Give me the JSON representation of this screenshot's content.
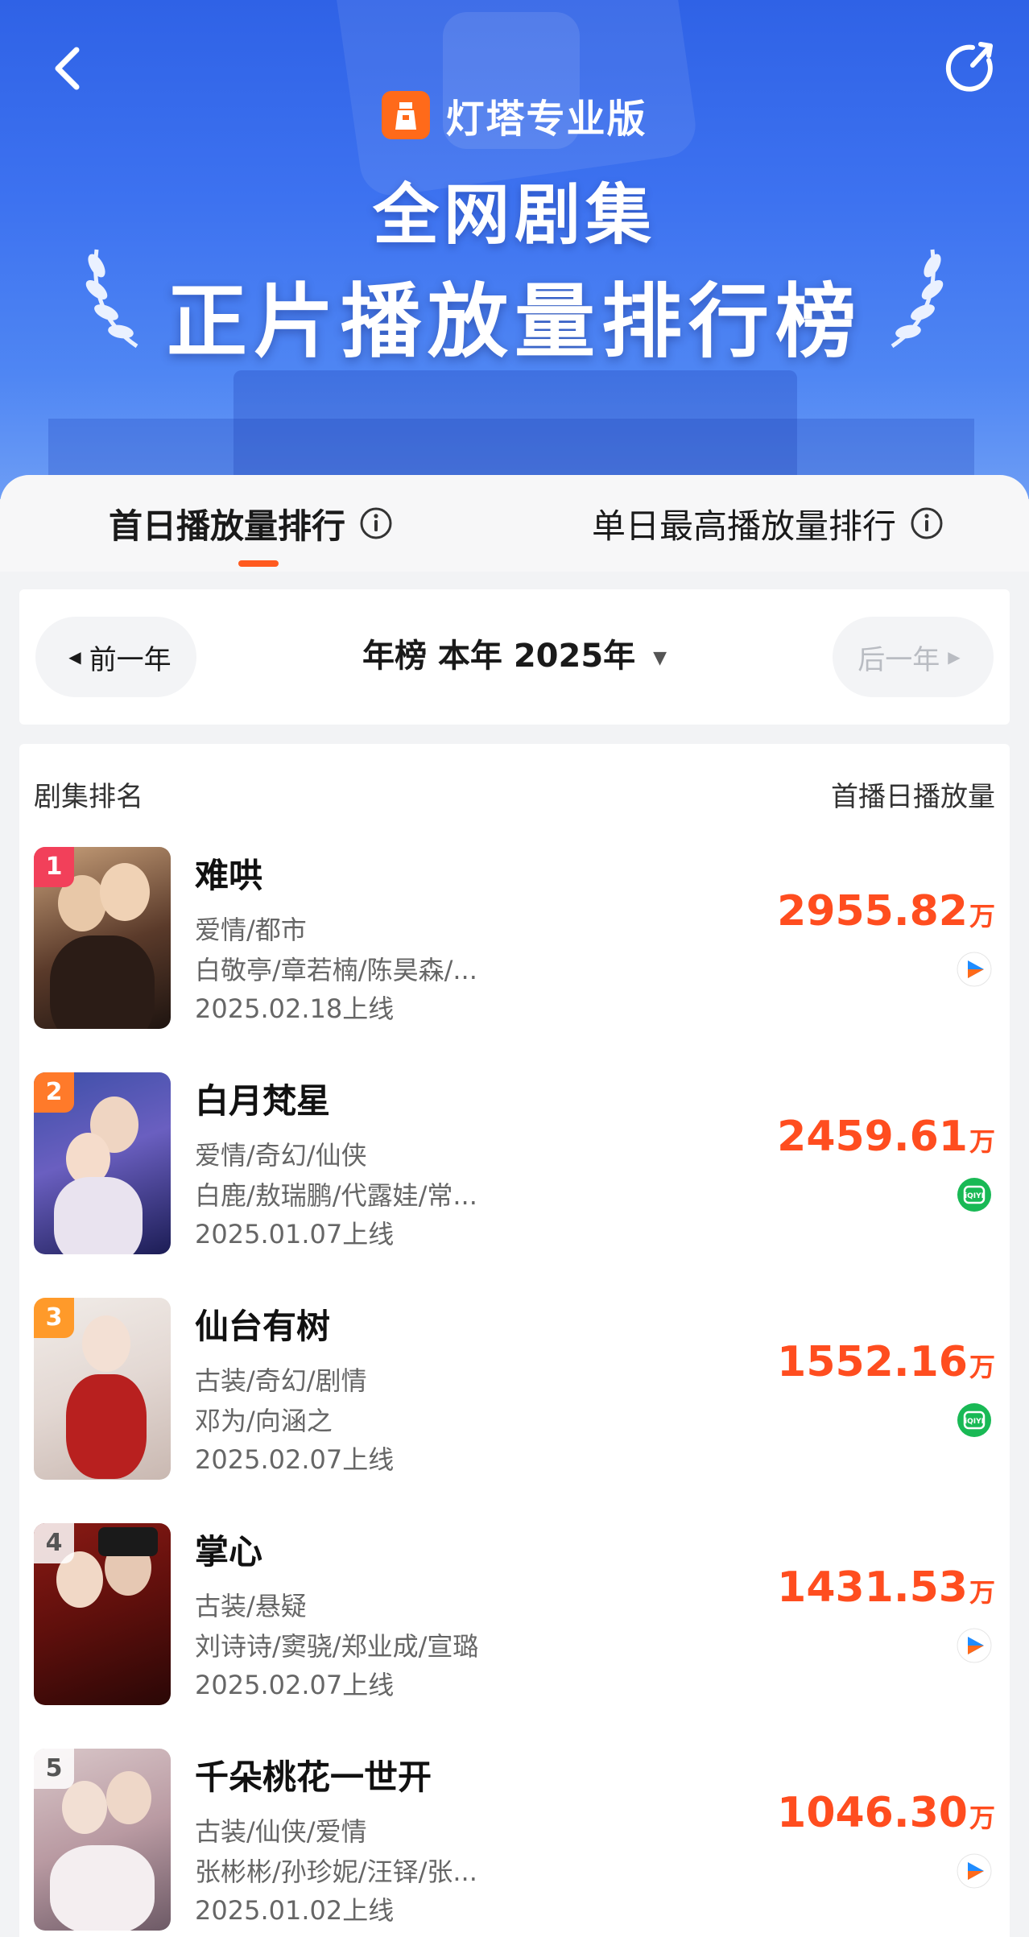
{
  "header": {
    "brand": "灯塔专业版",
    "title_line1": "全网剧集",
    "title_line2": "正片播放量排行榜"
  },
  "tabs": [
    {
      "label": "首日播放量排行",
      "active": true
    },
    {
      "label": "单日最高播放量排行",
      "active": false
    }
  ],
  "year_selector": {
    "prev_label": "前一年",
    "current_label": "年榜 本年 2025年",
    "next_label": "后一年"
  },
  "list": {
    "col_left": "剧集排名",
    "col_right": "首播日播放量",
    "items": [
      {
        "rank": "1",
        "name": "难哄",
        "genre": "爱情/都市",
        "cast": "白敬亭/章若楠/陈昊森/...",
        "date": "2025.02.18上线",
        "value": "2955.82",
        "unit": "万",
        "platform": "youku-icon"
      },
      {
        "rank": "2",
        "name": "白月梵星",
        "genre": "爱情/奇幻/仙侠",
        "cast": "白鹿/敖瑞鹏/代露娃/常...",
        "date": "2025.01.07上线",
        "value": "2459.61",
        "unit": "万",
        "platform": "iqiyi-icon"
      },
      {
        "rank": "3",
        "name": "仙台有树",
        "genre": "古装/奇幻/剧情",
        "cast": "邓为/向涵之",
        "date": "2025.02.07上线",
        "value": "1552.16",
        "unit": "万",
        "platform": "iqiyi-icon"
      },
      {
        "rank": "4",
        "name": "掌心",
        "genre": "古装/悬疑",
        "cast": "刘诗诗/窦骁/郑业成/宣璐",
        "date": "2025.02.07上线",
        "value": "1431.53",
        "unit": "万",
        "platform": "youku-icon"
      },
      {
        "rank": "5",
        "name": "千朵桃花一世开",
        "genre": "古装/仙侠/爱情",
        "cast": "张彬彬/孙珍妮/汪铎/张...",
        "date": "2025.01.02上线",
        "value": "1046.30",
        "unit": "万",
        "platform": "youku-icon"
      }
    ]
  },
  "colors": {
    "banner": "#3d72f0",
    "accent": "#ff4d1f",
    "iqiyi": "#19b955",
    "youku_blue": "#1f8cff",
    "youku_orange": "#ff6a1a"
  }
}
